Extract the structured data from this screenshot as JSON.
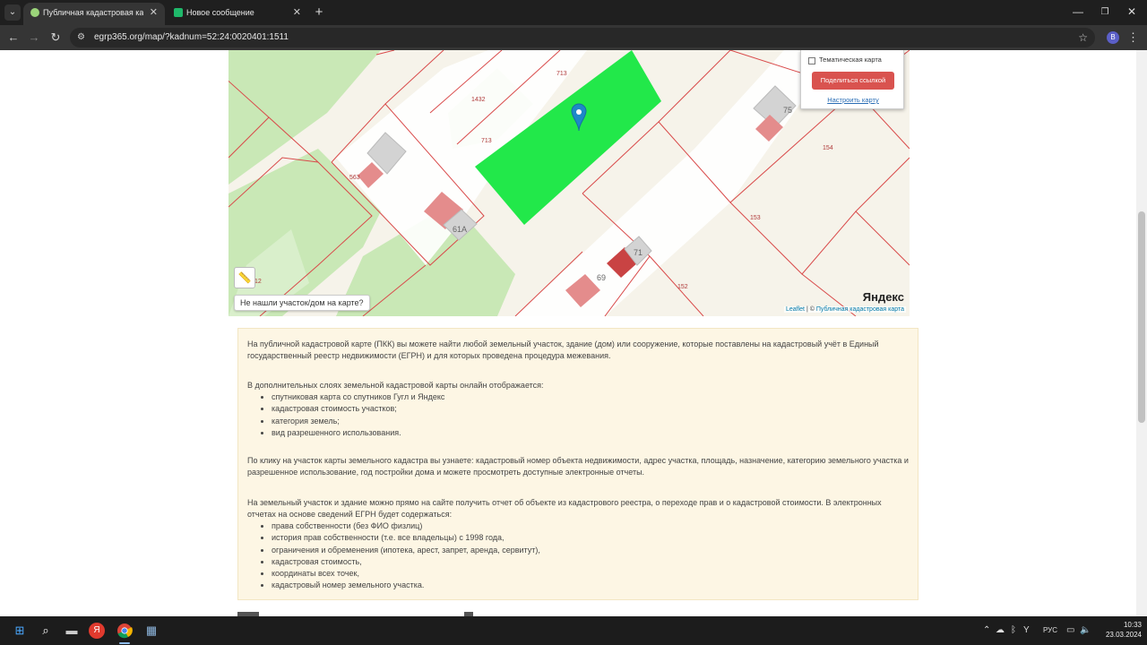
{
  "browser": {
    "tabs": [
      {
        "title": "Публичная кадастровая карта",
        "active": true
      },
      {
        "title": "Новое сообщение",
        "active": false
      }
    ],
    "url": "egrp365.org/map/?kadnum=52:24:0020401:1511",
    "profile_initial": "B"
  },
  "map": {
    "parcel_labels": [
      "713",
      "713",
      "1432",
      "563",
      "154",
      "153",
      "152",
      "12"
    ],
    "house_numbers": [
      "75",
      "61А",
      "71",
      "69"
    ],
    "layer_panel": {
      "thematic_checkbox_label": "Тематическая карта",
      "share_button": "Поделиться ссылкой",
      "setup_link": "Настроить карту"
    },
    "not_found_button": "Не нашли участок/дом на карте?",
    "provider_logo": "Яндекс",
    "attribution": {
      "leaflet": "Leaflet",
      "sep": " | © ",
      "pkk": "Публичная кадастровая карта"
    },
    "colors": {
      "selected_parcel": "#22e84a",
      "border": "#d94a4a",
      "greenery": "#c9e8b6",
      "road": "#ffffff"
    }
  },
  "info": {
    "p1": "На публичной кадастровой карте (ПКК) вы можете найти любой земельный участок, здание (дом) или сооружение, которые поставлены на кадастровый учёт в Единый государственный реестр недвижимости (ЕГРН) и для которых проведена процедура межевания.",
    "p2": "В дополнительных слоях земельной кадастровой карты онлайн отображается:",
    "list1": [
      "спутниковая карта со спутников Гугл и Яндекс",
      "кадастровая стоимость участков;",
      "категория земель;",
      "вид разрешенного использования."
    ],
    "p3": "По клику на участок карты земельного кадастра вы узнаете: кадастровый номер объекта недвижимости, адрес участка, площадь, назначение, категорию земельного участка и разрешенное использование, год постройки дома и можете просмотреть доступные электронные отчеты.",
    "p4": "На земельный участок и здание можно прямо на сайте получить отчет об объекте из кадастрового реестра, о переходе прав и о кадастровой стоимости. В электронных отчетах на основе сведений ЕГРН будет содержаться:",
    "list2": [
      "права собственности (без ФИО физлиц)",
      "история прав собственности (т.е. все владельцы) с 1998 года,",
      "ограничения и обременения (ипотека, арест, запрет, аренда, сервитут),",
      "кадастровая стоимость,",
      "координаты всех точек,",
      "кадастровый номер земельного участка."
    ]
  },
  "taskbar": {
    "language": "РУС",
    "time": "10:33",
    "date": "23.03.2024"
  }
}
